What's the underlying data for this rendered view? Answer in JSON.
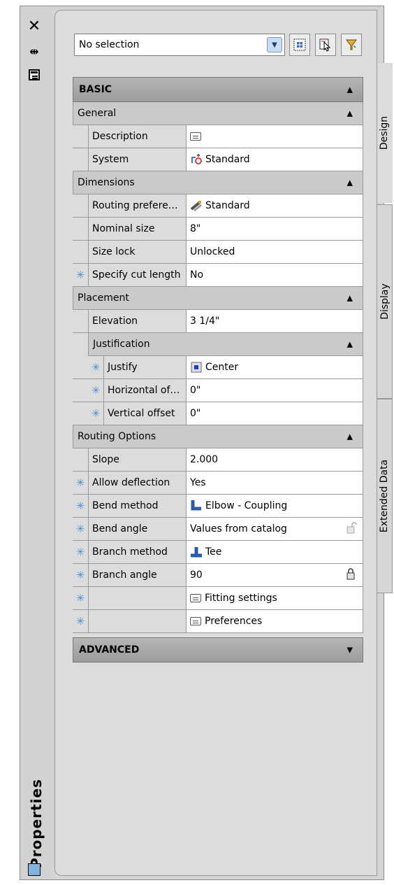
{
  "strip": {
    "title": "Properties",
    "icons": [
      "close-icon",
      "auto-hide-icon",
      "properties-menu-icon",
      "palette-icon"
    ]
  },
  "selection": {
    "value": "No selection",
    "tools": [
      "quick-select-icon",
      "pickadd-icon",
      "select-objects-icon"
    ]
  },
  "tabs": [
    "Design",
    "Display",
    "Extended Data"
  ],
  "grid": {
    "basic_label": "BASIC",
    "general": {
      "label": "General",
      "description_label": "Description",
      "system_label": "System",
      "system_value": "Standard"
    },
    "dimensions": {
      "label": "Dimensions",
      "routing_pref_label": "Routing prefere…",
      "routing_pref_value": "Standard",
      "nominal_size_label": "Nominal size",
      "nominal_size_value": "8\"",
      "size_lock_label": "Size lock",
      "size_lock_value": "Unlocked",
      "cut_length_label": "Specify cut length",
      "cut_length_value": "No"
    },
    "placement": {
      "label": "Placement",
      "elevation_label": "Elevation",
      "elevation_value": "3 1/4\"",
      "justification_label": "Justification",
      "justify_label": "Justify",
      "justify_value": "Center",
      "hoffset_label": "Horizontal of…",
      "hoffset_value": "0\"",
      "voffset_label": "Vertical offset",
      "voffset_value": "0\""
    },
    "routing_options": {
      "label": "Routing Options",
      "slope_label": "Slope",
      "slope_value": "2.000",
      "allow_deflection_label": "Allow deflection",
      "allow_deflection_value": "Yes",
      "bend_method_label": "Bend method",
      "bend_method_value": "Elbow - Coupling",
      "bend_angle_label": "Bend angle",
      "bend_angle_value": "Values from catalog",
      "branch_method_label": "Branch method",
      "branch_method_value": "Tee",
      "branch_angle_label": "Branch angle",
      "branch_angle_value": "90",
      "fitting_settings_label": "Fitting settings",
      "preferences_label": "Preferences"
    },
    "advanced_label": "ADVANCED"
  },
  "colors": {
    "accent": "#4a8fd0",
    "header": "#a8a8a8",
    "panel": "#dcdcdc"
  }
}
